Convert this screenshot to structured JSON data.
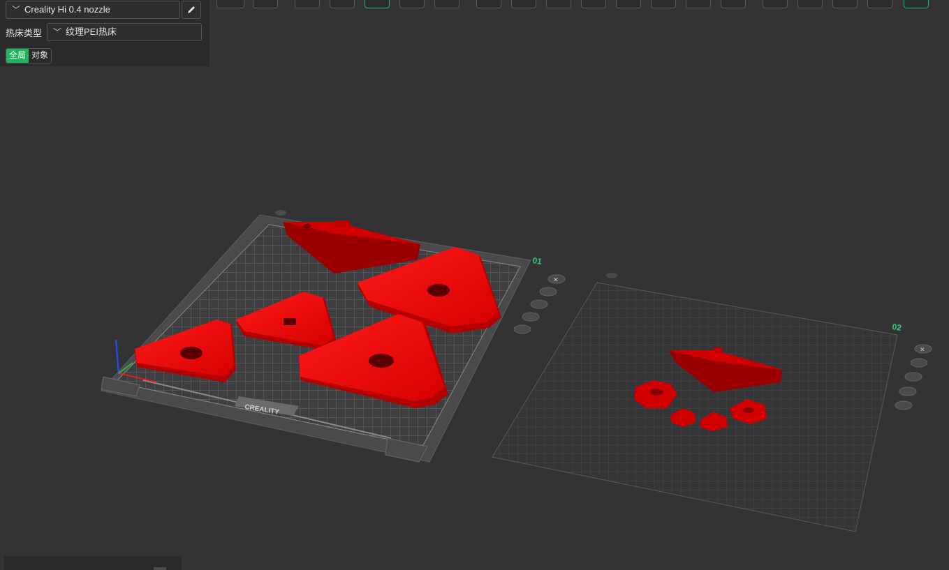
{
  "printer": {
    "name": "Creality Hi 0.4 nozzle",
    "chevron": "﹀",
    "edit_icon": "pencil-icon"
  },
  "bed": {
    "label": "热床类型",
    "value": "纹理PEI热床",
    "chevron": "﹀"
  },
  "scope_tabs": [
    {
      "label": "全局",
      "active": true
    },
    {
      "label": "对象",
      "active": false
    }
  ],
  "plates": [
    {
      "label": "01",
      "label_color": "#2ecf6f"
    },
    {
      "label": "02",
      "label_color": "#2ecf6f"
    }
  ],
  "plate_brand": "CREALITY",
  "colors": {
    "model": "#e00000",
    "accent": "#21b65d",
    "background": "#333335",
    "panel": "#2a2a2c"
  }
}
